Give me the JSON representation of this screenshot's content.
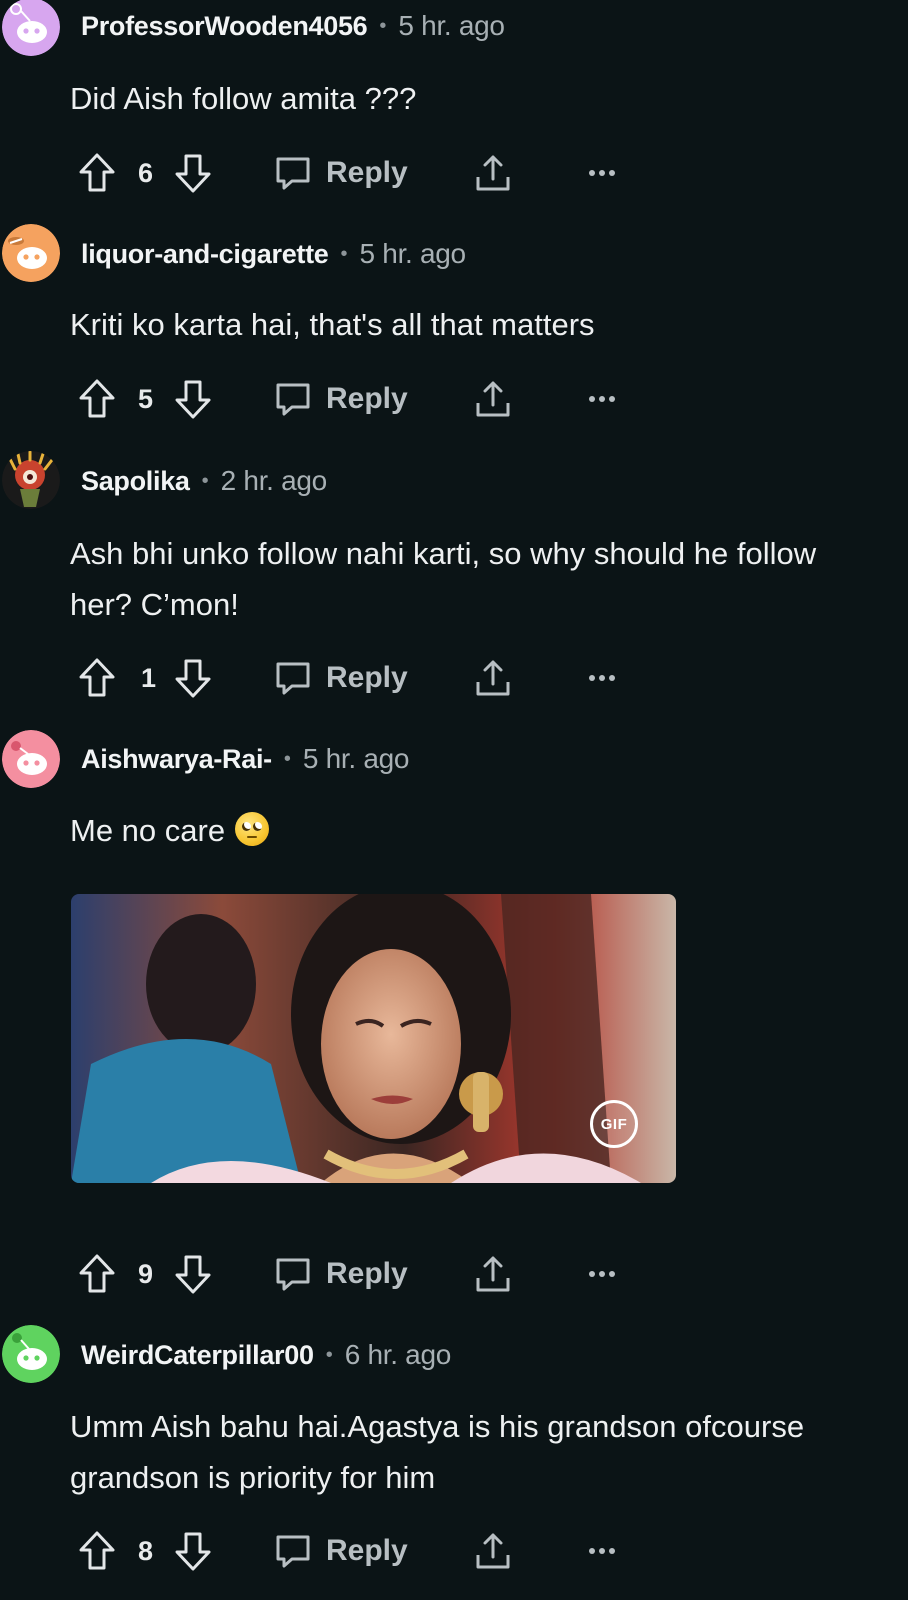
{
  "comments": [
    {
      "username": "ProfessorWooden4056",
      "time": "5 hr. ago",
      "body": "Did Aish follow amita ???",
      "score": "6",
      "reply_label": "Reply",
      "avatar_color": "#d7a6ef"
    },
    {
      "username": "liquor-and-cigarette",
      "time": "5 hr. ago",
      "body": "Kriti ko karta hai, that's all that matters",
      "score": "5",
      "reply_label": "Reply",
      "avatar_color": "#f5a25f"
    },
    {
      "username": "Sapolika",
      "time": "2 hr. ago",
      "body": "Ash bhi unko follow nahi karti, so why should he follow her? C’mon!",
      "score": "1",
      "reply_label": "Reply",
      "avatar_color": "#1a1a1a"
    },
    {
      "username": "Aishwarya-Rai-",
      "time": "5 hr. ago",
      "body": "Me no care",
      "emoji": "face-with-rolling-eyes",
      "gif_badge": "GIF",
      "score": "9",
      "reply_label": "Reply",
      "avatar_color": "#f48fa0"
    },
    {
      "username": "WeirdCaterpillar00",
      "time": "6 hr. ago",
      "body": "Umm Aish bahu hai.Agastya is his grandson ofcourse grandson is priority for him",
      "score": "8",
      "reply_label": "Reply",
      "avatar_color": "#5fd35f"
    }
  ],
  "separator": "•",
  "colors": {
    "background": "#0b1416",
    "text": "#eef0f1",
    "muted": "#a8b0b4"
  }
}
